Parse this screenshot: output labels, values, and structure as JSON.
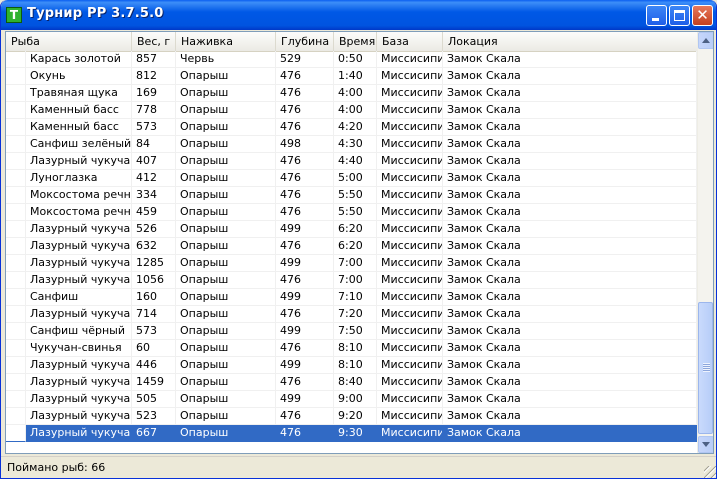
{
  "window": {
    "title": "Турнир РР 3.7.5.0",
    "icon_letter": "T"
  },
  "columns": [
    "Рыба",
    "Вес, г",
    "Наживка",
    "Глубина",
    "Время",
    "База",
    "Локация"
  ],
  "rows": [
    [
      "Карась золотой",
      "857",
      "Червь",
      "529",
      "0:50",
      "Миссисипи",
      "Замок Скала"
    ],
    [
      "Окунь",
      "812",
      "Опарыш",
      "476",
      "1:40",
      "Миссисипи",
      "Замок Скала"
    ],
    [
      "Травяная щука",
      "169",
      "Опарыш",
      "476",
      "4:00",
      "Миссисипи",
      "Замок Скала"
    ],
    [
      "Каменный басс",
      "778",
      "Опарыш",
      "476",
      "4:00",
      "Миссисипи",
      "Замок Скала"
    ],
    [
      "Каменный басс",
      "573",
      "Опарыш",
      "476",
      "4:20",
      "Миссисипи",
      "Замок Скала"
    ],
    [
      "Санфиш зелёный",
      "84",
      "Опарыш",
      "498",
      "4:30",
      "Миссисипи",
      "Замок Скала"
    ],
    [
      "Лазурный чукучан",
      "407",
      "Опарыш",
      "476",
      "4:40",
      "Миссисипи",
      "Замок Скала"
    ],
    [
      "Луноглазка",
      "412",
      "Опарыш",
      "476",
      "5:00",
      "Миссисипи",
      "Замок Скала"
    ],
    [
      "Моксостома речная",
      "334",
      "Опарыш",
      "476",
      "5:50",
      "Миссисипи",
      "Замок Скала"
    ],
    [
      "Моксостома речная",
      "459",
      "Опарыш",
      "476",
      "5:50",
      "Миссисипи",
      "Замок Скала"
    ],
    [
      "Лазурный чукучан",
      "526",
      "Опарыш",
      "499",
      "6:20",
      "Миссисипи",
      "Замок Скала"
    ],
    [
      "Лазурный чукучан",
      "632",
      "Опарыш",
      "476",
      "6:20",
      "Миссисипи",
      "Замок Скала"
    ],
    [
      "Лазурный чукучан",
      "1285",
      "Опарыш",
      "499",
      "7:00",
      "Миссисипи",
      "Замок Скала"
    ],
    [
      "Лазурный чукучан",
      "1056",
      "Опарыш",
      "476",
      "7:00",
      "Миссисипи",
      "Замок Скала"
    ],
    [
      "Санфиш",
      "160",
      "Опарыш",
      "499",
      "7:10",
      "Миссисипи",
      "Замок Скала"
    ],
    [
      "Лазурный чукучан",
      "714",
      "Опарыш",
      "476",
      "7:20",
      "Миссисипи",
      "Замок Скала"
    ],
    [
      "Санфиш чёрный",
      "573",
      "Опарыш",
      "499",
      "7:50",
      "Миссисипи",
      "Замок Скала"
    ],
    [
      "Чукучан-свинья",
      "60",
      "Опарыш",
      "476",
      "8:10",
      "Миссисипи",
      "Замок Скала"
    ],
    [
      "Лазурный чукучан",
      "446",
      "Опарыш",
      "499",
      "8:10",
      "Миссисипи",
      "Замок Скала"
    ],
    [
      "Лазурный чукучан",
      "1459",
      "Опарыш",
      "476",
      "8:40",
      "Миссисипи",
      "Замок Скала"
    ],
    [
      "Лазурный чукучан",
      "505",
      "Опарыш",
      "499",
      "9:00",
      "Миссисипи",
      "Замок Скала"
    ],
    [
      "Лазурный чукучан",
      "523",
      "Опарыш",
      "476",
      "9:20",
      "Миссисипи",
      "Замок Скала"
    ],
    [
      "Лазурный чукучан",
      "667",
      "Опарыш",
      "476",
      "9:30",
      "Миссисипи",
      "Замок Скала"
    ]
  ],
  "selected_row": 22,
  "status": {
    "text": "Поймано рыб: 66"
  },
  "colors": {
    "titlebar": "#0054e0",
    "selection": "#316ac5"
  }
}
